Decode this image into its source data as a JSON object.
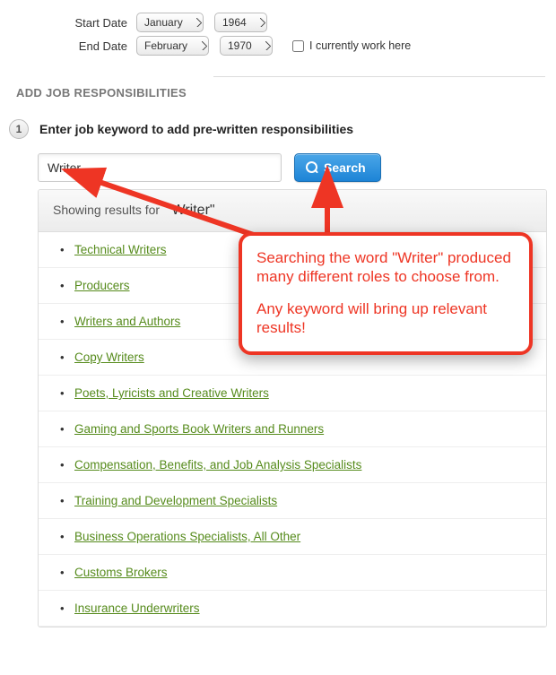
{
  "dates": {
    "start_label": "Start Date",
    "end_label": "End Date",
    "start_month": "January",
    "start_year": "1964",
    "end_month": "February",
    "end_year": "1970",
    "current_label": "I currently work here"
  },
  "section": {
    "title": "ADD JOB RESPONSIBILITIES"
  },
  "step": {
    "number": "1",
    "text": "Enter job keyword to add pre-written responsibilities"
  },
  "search": {
    "value": "Writer",
    "button": "Search"
  },
  "results": {
    "showing_prefix": "Showing results for",
    "query": "\"Writer\"",
    "items": [
      "Technical Writers",
      "Producers",
      "Writers and Authors",
      "Copy Writers",
      "Poets, Lyricists and Creative Writers",
      "Gaming and Sports Book Writers and Runners",
      "Compensation, Benefits, and Job Analysis Specialists",
      "Training and Development Specialists",
      "Business Operations Specialists, All Other",
      "Customs Brokers",
      "Insurance Underwriters"
    ]
  },
  "annotation": {
    "line1": "Searching the word \"Writer\" produced many different roles to choose from.",
    "line2": "Any keyword will bring up relevant results!"
  }
}
